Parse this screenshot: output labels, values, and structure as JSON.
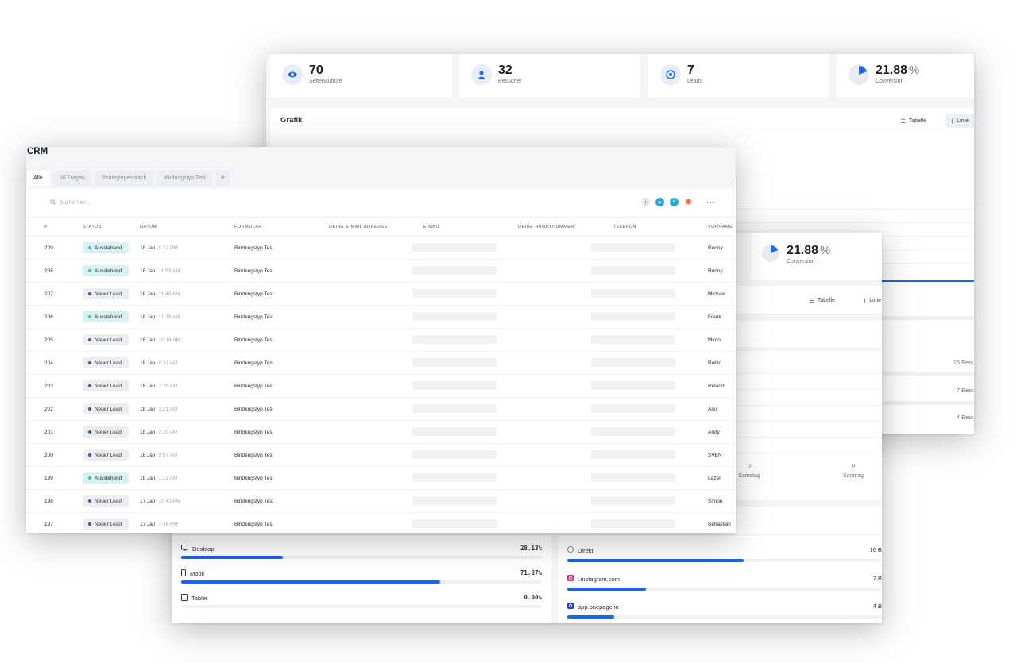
{
  "back": {
    "stats": [
      {
        "value": "70",
        "label": "Seitenaufrufe",
        "icon": "eye-icon"
      },
      {
        "value": "32",
        "label": "Besucher",
        "icon": "user-icon"
      },
      {
        "value": "7",
        "label": "Leads",
        "icon": "target-icon"
      },
      {
        "value": "21.88",
        "unit": "%",
        "label": "Conversion",
        "icon": "pie-icon"
      }
    ],
    "panel_title": "Grafik",
    "toggle_table": "Tabelle",
    "toggle_line": "Linie",
    "side_counts": [
      {
        "count": "16",
        "label": "Besuc"
      },
      {
        "count": "7",
        "label": "Besuc"
      },
      {
        "count": "4",
        "label": "Besuc"
      }
    ]
  },
  "mid": {
    "stat": {
      "value": "21.88",
      "unit": "%",
      "label": "Conversion"
    },
    "toggle_table": "Tabelle",
    "toggle_line": "Linie",
    "weekdays": [
      {
        "value": "0",
        "day": "Samstag"
      },
      {
        "value": "0",
        "day": "Sonntag"
      }
    ],
    "devices": [
      {
        "name": "Desktop",
        "value": "28.13%",
        "fraction": 0.2813,
        "icon": "desktop-icon"
      },
      {
        "name": "Mobil",
        "value": "71.87%",
        "fraction": 0.7187,
        "icon": "mobile-icon"
      },
      {
        "name": "Tablet",
        "value": "0.00%",
        "fraction": 0.0,
        "icon": "tablet-icon"
      }
    ],
    "sources": [
      {
        "name": "Direkt",
        "value": "16 B",
        "fraction": 0.56,
        "icon": "globe-icon"
      },
      {
        "name": "l.instagram.com",
        "value": "7 B",
        "fraction": 0.25,
        "icon": "instagram-icon"
      },
      {
        "name": "app.onepage.io",
        "value": "4 B",
        "fraction": 0.15,
        "icon": "onepage-icon"
      }
    ]
  },
  "crm": {
    "title": "CRM",
    "tabs": [
      "Alle",
      "50 Fragen",
      "Strategiegespräch",
      "Bindungstyp Test",
      "+"
    ],
    "search_placeholder": "Suche hier...",
    "more": "···",
    "columns": [
      "#",
      "Status",
      "Datum",
      "Formular",
      "Deine E Mail Adresse:",
      "E Mail",
      "Deine Handynummer:",
      "Telefon",
      "Vorname"
    ],
    "rows": [
      {
        "id": "209",
        "status": "Ausstehend",
        "date": "18 Jan",
        "time": "5:27 PM",
        "form": "Bindungstyp Test",
        "name": "Ronny"
      },
      {
        "id": "208",
        "status": "Ausstehend",
        "date": "18 Jan",
        "time": "11:53 AM",
        "form": "Bindungstyp Test",
        "name": "Ronny"
      },
      {
        "id": "207",
        "status": "Neuer Lead",
        "date": "18 Jan",
        "time": "11:45 AM",
        "form": "Bindungstyp Test",
        "name": "Michael"
      },
      {
        "id": "206",
        "status": "Ausstehend",
        "date": "18 Jan",
        "time": "11:29 AM",
        "form": "Bindungstyp Test",
        "name": "Frank"
      },
      {
        "id": "205",
        "status": "Neuer Lead",
        "date": "18 Jan",
        "time": "10:14 AM",
        "form": "Bindungstyp Test",
        "name": "Mirco"
      },
      {
        "id": "204",
        "status": "Neuer Lead",
        "date": "18 Jan",
        "time": "8:33 AM",
        "form": "Bindungstyp Test",
        "name": "Robin"
      },
      {
        "id": "203",
        "status": "Neuer Lead",
        "date": "18 Jan",
        "time": "7:25 AM",
        "form": "Bindungstyp Test",
        "name": "Roland"
      },
      {
        "id": "202",
        "status": "Neuer Lead",
        "date": "18 Jan",
        "time": "3:21 AM",
        "form": "Bindungstyp Test",
        "name": "Alex"
      },
      {
        "id": "201",
        "status": "Neuer Lead",
        "date": "18 Jan",
        "time": "2:20 AM",
        "form": "Bindungstyp Test",
        "name": "Andy"
      },
      {
        "id": "200",
        "status": "Neuer Lead",
        "date": "18 Jan",
        "time": "2:07 AM",
        "form": "Bindungstyp Test",
        "name": "SVEN"
      },
      {
        "id": "199",
        "status": "Ausstehend",
        "date": "18 Jan",
        "time": "1:12 AM",
        "form": "Bindungstyp Test",
        "name": "Lazer"
      },
      {
        "id": "198",
        "status": "Neuer Lead",
        "date": "17 Jan",
        "time": "10:43 PM",
        "form": "Bindungstyp Test",
        "name": "Simon"
      },
      {
        "id": "197",
        "status": "Neuer Lead",
        "date": "17 Jan",
        "time": "7:48 PM",
        "form": "Bindungstyp Test",
        "name": "Sebastian"
      }
    ]
  },
  "colors": {
    "accent": "#1a66e8",
    "pending_badge": "#d8f2f4",
    "lead_badge": "#eceef1"
  }
}
